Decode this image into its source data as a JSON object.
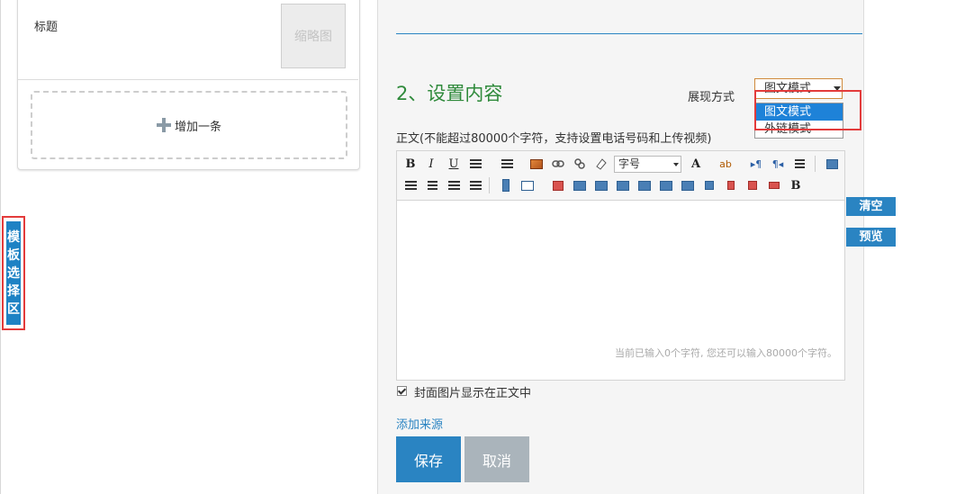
{
  "left": {
    "card": {
      "title": "标题",
      "thumbnail": "缩略图",
      "add_item": "增加一条"
    },
    "template_tab": {
      "chars": [
        "模",
        "板",
        "选",
        "择",
        "区"
      ]
    }
  },
  "right": {
    "section_title": "2、设置内容",
    "display_mode": {
      "label": "展现方式",
      "selected": "图文模式",
      "options": [
        "图文模式",
        "外链模式"
      ]
    },
    "body_hint": "正文(不能超过80000个字符，支持设置电话号码和上传视频)",
    "editor": {
      "toolbar": {
        "bold": "B",
        "italic": "I",
        "underline": "U",
        "font_size": "字号",
        "font_color": "A",
        "backcolor": "ab",
        "para_ltr": "▸¶",
        "para_rtl": "¶◂",
        "letter_b": "B"
      },
      "char_count": "当前已输入0个字符, 您还可以输入80000个字符。"
    },
    "side_buttons": {
      "clear": "清空",
      "preview": "预览"
    },
    "cover_checkbox": {
      "label": "封面图片显示在正文中",
      "checked": true
    },
    "add_source": "添加来源",
    "buttons": {
      "save": "保存",
      "cancel": "取消"
    }
  },
  "colors": {
    "primary_blue": "#2a84c2",
    "section_green": "#2f8a3b",
    "highlight_red": "#e33b3b",
    "cancel_gray": "#aab4bb"
  }
}
